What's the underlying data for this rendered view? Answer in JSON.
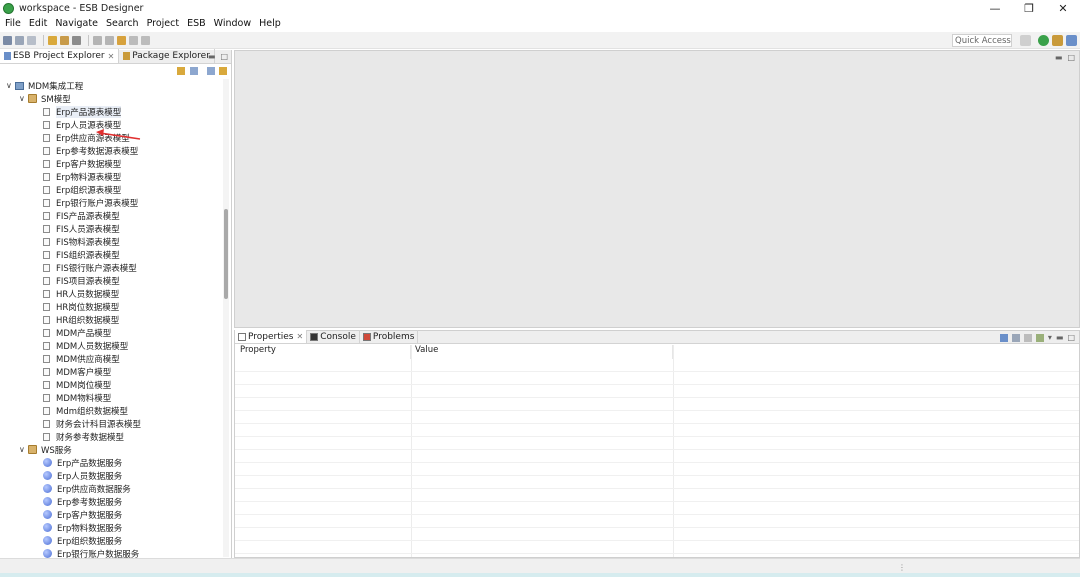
{
  "window": {
    "title": "workspace - ESB Designer",
    "controls": [
      "minimize-icon",
      "restore-icon",
      "close-icon"
    ]
  },
  "menu": [
    "File",
    "Edit",
    "Navigate",
    "Search",
    "Project",
    "ESB",
    "Window",
    "Help"
  ],
  "toolbar": {
    "quick_access": "Quick Access"
  },
  "left_panel": {
    "tabs": [
      {
        "label": "ESB Project Explorer",
        "active": true
      },
      {
        "label": "Package Explorer",
        "active": false
      }
    ],
    "tree": {
      "project": "MDM集成工程",
      "groups": [
        {
          "label": "SM模型",
          "items": [
            "Erp产品源表模型",
            "Erp人员源表模型",
            "Erp供应商源表模型",
            "Erp参考数据源表模型",
            "Erp客户数据模型",
            "Erp物料源表模型",
            "Erp组织源表模型",
            "Erp银行账户源表模型",
            "FIS产品源表模型",
            "FIS人员源表模型",
            "FIS物料源表模型",
            "FIS组织源表模型",
            "FIS银行账户源表模型",
            "FIS项目源表模型",
            "HR人员数据模型",
            "HR岗位数据模型",
            "HR组织数据模型",
            "MDM产品模型",
            "MDM人员数据模型",
            "MDM供应商模型",
            "MDM客户模型",
            "MDM岗位模型",
            "MDM物料模型",
            "Mdm组织数据模型",
            "财务会计科目源表模型",
            "财务参考数据模型"
          ]
        },
        {
          "label": "WS服务",
          "items": [
            "Erp产品数据服务",
            "Erp人员数据服务",
            "Erp供应商数据服务",
            "Erp参考数据服务",
            "Erp客户数据服务",
            "Erp物料数据服务",
            "Erp组织数据服务",
            "Erp银行账户数据服务"
          ]
        }
      ]
    }
  },
  "bottom_panel": {
    "tabs": [
      {
        "label": "Properties",
        "active": true
      },
      {
        "label": "Console",
        "active": false
      },
      {
        "label": "Problems",
        "active": false
      }
    ],
    "columns": [
      "Property",
      "Value"
    ]
  },
  "colors": {
    "editor_bg": "#e8e8e8",
    "selection": "#e9eef6",
    "arrow": "#e03030"
  }
}
